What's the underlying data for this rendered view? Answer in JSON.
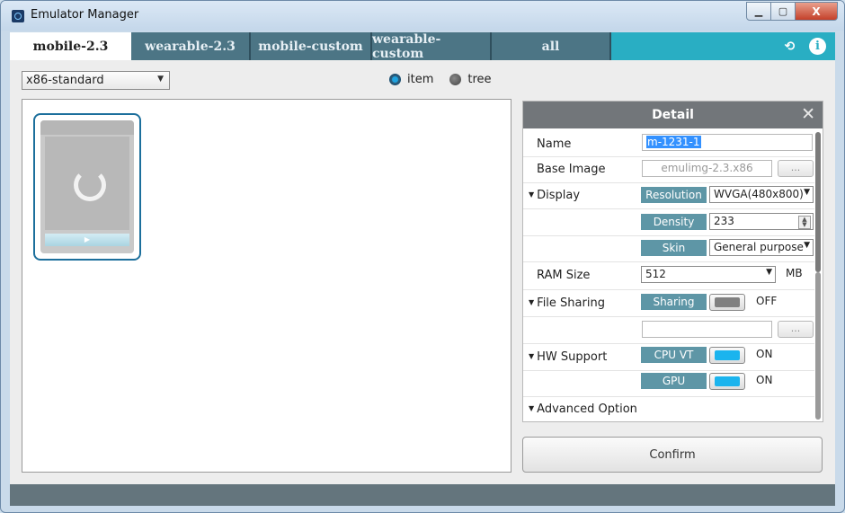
{
  "window": {
    "title": "Emulator Manager",
    "minimize": "▁",
    "maximize": "▢",
    "close": "X"
  },
  "tabs": [
    {
      "label": "mobile-2.3"
    },
    {
      "label": "wearable-2.3"
    },
    {
      "label": "mobile-custom"
    },
    {
      "label": "wearable-custom"
    },
    {
      "label": "all"
    }
  ],
  "tab_icons": {
    "refresh": "⟲",
    "info": "i"
  },
  "toolbar": {
    "platform_value": "x86-standard",
    "view_item_label": "item",
    "view_tree_label": "tree"
  },
  "device_card": {
    "play_icon": "▶"
  },
  "detail": {
    "title": "Detail",
    "close": "✕",
    "name_label": "Name",
    "name_value": "m-1231-1",
    "base_image_label": "Base Image",
    "base_image_value": "emulimg-2.3.x86",
    "browse": "...",
    "display_label": "Display",
    "resolution_tag": "Resolution",
    "resolution_value": "WVGA(480x800)",
    "density_tag": "Density",
    "density_value": "233",
    "skin_tag": "Skin",
    "skin_value": "General purpose",
    "ram_label": "RAM Size",
    "ram_value": "512",
    "ram_unit": "MB",
    "file_sharing_label": "File Sharing",
    "sharing_tag": "Sharing",
    "sharing_state": "OFF",
    "sharing_path": "",
    "hw_label": "HW Support",
    "cpuvt_tag": "CPU VT",
    "cpuvt_state": "ON",
    "gpu_tag": "GPU",
    "gpu_state": "ON",
    "advanced_label": "Advanced Option"
  },
  "confirm_label": "Confirm"
}
